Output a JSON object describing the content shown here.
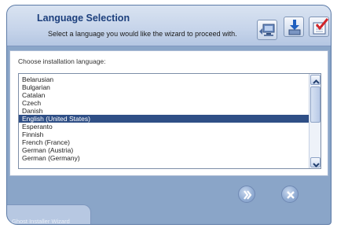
{
  "header": {
    "title": "Language Selection",
    "subtitle": "Select a language you would like the wizard to proceed with.",
    "icons": [
      "network-computer-icon",
      "download-icon",
      "checklist-icon"
    ]
  },
  "panel": {
    "label": "Choose installation language:"
  },
  "languages": {
    "items": [
      "Belarusian",
      "Bulgarian",
      "Catalan",
      "Czech",
      "Danish",
      "English (United States)",
      "Esperanto",
      "Finnish",
      "French (France)",
      "German (Austria)",
      "German (Germany)"
    ],
    "selected": "English (United States)"
  },
  "footer": {
    "next_icon": "next-icon",
    "close_icon": "close-icon",
    "tab_label": "Ghost Installer Wizard"
  },
  "colors": {
    "selection": "#2f4f86",
    "title": "#1c3f7c",
    "frame": "#8aa5c8"
  }
}
